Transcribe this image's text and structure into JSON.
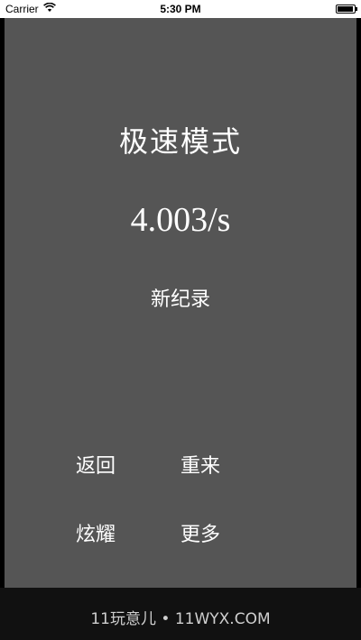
{
  "status_bar": {
    "carrier": "Carrier",
    "time": "5:30 PM",
    "wifi_icon": "wifi-icon",
    "battery_icon": "battery-icon",
    "battery_level": 0.95
  },
  "game": {
    "mode_title": "极速模式",
    "result_time": "4.003/s",
    "record_label": "新纪录"
  },
  "buttons": {
    "back": "返回",
    "retry": "重来",
    "show_off": "炫耀",
    "more": "更多"
  },
  "watermark": "11玩意儿 • 11WYX.COM",
  "colors": {
    "screen_bg": "#555555",
    "text": "#ffffff"
  }
}
